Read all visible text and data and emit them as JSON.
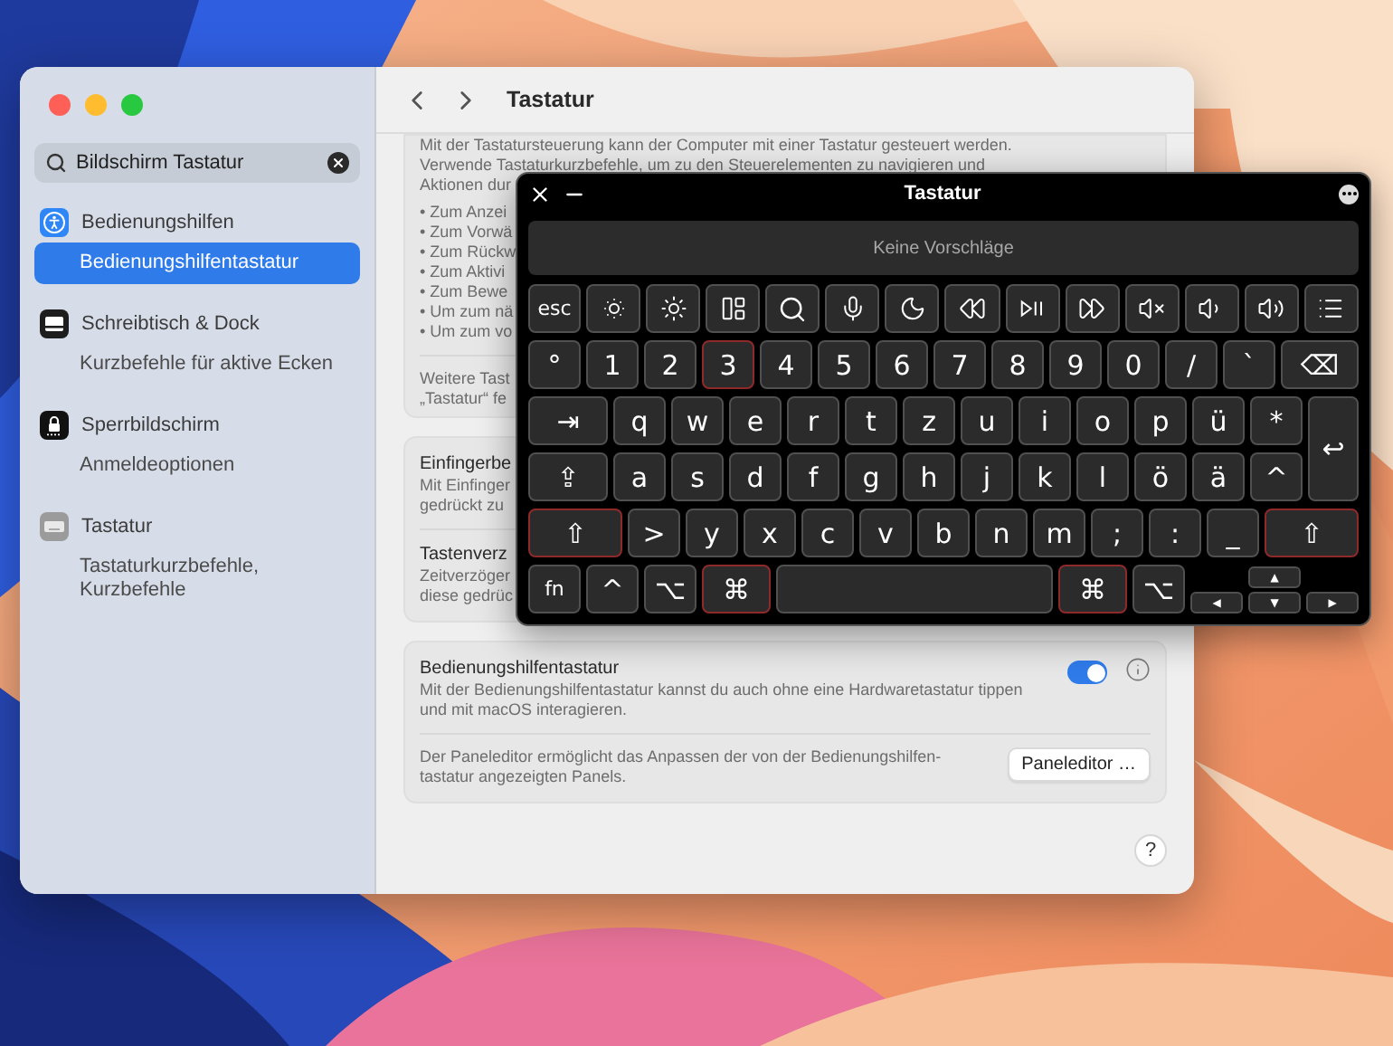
{
  "settings": {
    "search": {
      "value": "Bildschirm Tastatur"
    },
    "sidebar": [
      {
        "title": "Bedienungshilfen",
        "selected": false,
        "items": [
          {
            "label": "Bedienungshilfentastatur",
            "selected": true
          }
        ]
      },
      {
        "title": "Schreibtisch & Dock",
        "selected": false,
        "items": [
          {
            "label": "Kurzbefehle für aktive Ecken",
            "selected": false
          }
        ]
      },
      {
        "title": "Sperrbildschirm",
        "selected": false,
        "items": [
          {
            "label": "Anmeldeoptionen",
            "selected": false
          }
        ]
      },
      {
        "title": "Tastatur",
        "selected": false,
        "items": [
          {
            "label": "Tastaturkurzbefehle, Kurzbefehle",
            "selected": false
          }
        ]
      }
    ],
    "header": {
      "title": "Tastatur"
    },
    "keyboard_control": {
      "lines": [
        "Mit der Tastatursteuerung kann der Computer mit einer Tastatur gesteuert werden.",
        "Verwende Tastaturkurzbefehle, um zu den Steuerelementen zu navigieren und",
        "Aktionen dur"
      ],
      "bullets": [
        "• Zum Anzei",
        "• Zum Vorwä",
        "• Zum Rückw",
        "• Zum Aktivi",
        "• Zum Bewe",
        "• Um zum nä",
        "• Um zum vo"
      ],
      "more_lines": [
        "Weitere Tast",
        "„Tastatur“ fe"
      ]
    },
    "sections": [
      {
        "title": "Einfingerbe",
        "lines": [
          "Mit Einfinger",
          "gedrückt zu"
        ]
      },
      {
        "title": "Tastenverz",
        "lines": [
          "Zeitverzöger",
          "diese gedrüc"
        ]
      }
    ],
    "accessibility_keyboard": {
      "title": "Bedienungshilfentastatur",
      "description": "Mit der Bedienungshilfentastatur kannst du auch ohne eine Hardwaretastatur tippen und mit macOS interagieren.",
      "enabled": true,
      "panel_text": "Der Paneleditor ermöglicht das Anpassen der von der Bedienungshilfen-tastatur angezeigten Panels.",
      "panel_button": "Paneleditor …"
    },
    "help": "?"
  },
  "keyboard": {
    "title": "Tastatur",
    "suggestions": "Keine Vorschläge",
    "key_rows": [
      {
        "keys": [
          {
            "kind": "key",
            "label": "esc",
            "highlighted": false
          },
          {
            "kind": "icon",
            "highlighted": false
          },
          {
            "kind": "icon",
            "highlighted": false
          },
          {
            "kind": "icon",
            "highlighted": false
          },
          {
            "kind": "icon",
            "highlighted": false
          },
          {
            "kind": "icon",
            "highlighted": false
          },
          {
            "kind": "icon",
            "highlighted": false
          },
          {
            "kind": "icon",
            "highlighted": false
          },
          {
            "kind": "icon",
            "highlighted": false
          },
          {
            "kind": "icon",
            "highlighted": false
          },
          {
            "kind": "icon",
            "highlighted": false
          },
          {
            "kind": "icon",
            "highlighted": false
          },
          {
            "kind": "icon",
            "highlighted": false
          },
          {
            "kind": "icon",
            "highlighted": false
          }
        ]
      },
      {
        "keys": [
          {
            "kind": "key",
            "label": "°",
            "highlighted": false
          },
          {
            "kind": "key",
            "label": "1",
            "highlighted": false
          },
          {
            "kind": "key",
            "label": "2",
            "highlighted": false
          },
          {
            "kind": "key",
            "label": "3",
            "highlighted": true
          },
          {
            "kind": "key",
            "label": "4",
            "highlighted": false
          },
          {
            "kind": "key",
            "label": "5",
            "highlighted": false
          },
          {
            "kind": "key",
            "label": "6",
            "highlighted": false
          },
          {
            "kind": "key",
            "label": "7",
            "highlighted": false
          },
          {
            "kind": "key",
            "label": "8",
            "highlighted": false
          },
          {
            "kind": "key",
            "label": "9",
            "highlighted": false
          },
          {
            "kind": "key",
            "label": "0",
            "highlighted": false
          },
          {
            "kind": "key",
            "label": "/",
            "highlighted": false
          },
          {
            "kind": "key",
            "label": "`",
            "highlighted": false
          },
          {
            "kind": "wide",
            "label": "⌫",
            "highlighted": false
          }
        ]
      },
      {
        "keys": [
          {
            "kind": "wide",
            "label": "⇥",
            "highlighted": false
          },
          {
            "kind": "key",
            "label": "q",
            "highlighted": false
          },
          {
            "kind": "key",
            "label": "w",
            "highlighted": false
          },
          {
            "kind": "key",
            "label": "e",
            "highlighted": false
          },
          {
            "kind": "key",
            "label": "r",
            "highlighted": false
          },
          {
            "kind": "key",
            "label": "t",
            "highlighted": false
          },
          {
            "kind": "key",
            "label": "z",
            "highlighted": false
          },
          {
            "kind": "key",
            "label": "u",
            "highlighted": false
          },
          {
            "kind": "key",
            "label": "i",
            "highlighted": false
          },
          {
            "kind": "key",
            "label": "o",
            "highlighted": false
          },
          {
            "kind": "key",
            "label": "p",
            "highlighted": false
          },
          {
            "kind": "key",
            "label": "ü",
            "highlighted": false
          },
          {
            "kind": "key",
            "label": "*",
            "highlighted": false
          }
        ]
      },
      {
        "keys": [
          {
            "kind": "wide",
            "label": "⇪",
            "highlighted": false
          },
          {
            "kind": "key",
            "label": "a",
            "highlighted": false
          },
          {
            "kind": "key",
            "label": "s",
            "highlighted": false
          },
          {
            "kind": "key",
            "label": "d",
            "highlighted": false
          },
          {
            "kind": "key",
            "label": "f",
            "highlighted": false
          },
          {
            "kind": "key",
            "label": "g",
            "highlighted": false
          },
          {
            "kind": "key",
            "label": "h",
            "highlighted": false
          },
          {
            "kind": "key",
            "label": "j",
            "highlighted": false
          },
          {
            "kind": "key",
            "label": "k",
            "highlighted": false
          },
          {
            "kind": "key",
            "label": "l",
            "highlighted": false
          },
          {
            "kind": "key",
            "label": "ö",
            "highlighted": false
          },
          {
            "kind": "key",
            "label": "ä",
            "highlighted": false
          },
          {
            "kind": "key",
            "label": "^",
            "highlighted": false
          }
        ]
      },
      {
        "keys": [
          {
            "kind": "wide",
            "label": "⇧",
            "highlighted": true
          },
          {
            "kind": "key",
            "label": ">",
            "highlighted": false
          },
          {
            "kind": "key",
            "label": "y",
            "highlighted": false
          },
          {
            "kind": "key",
            "label": "x",
            "highlighted": false
          },
          {
            "kind": "key",
            "label": "c",
            "highlighted": false
          },
          {
            "kind": "key",
            "label": "v",
            "highlighted": false
          },
          {
            "kind": "key",
            "label": "b",
            "highlighted": false
          },
          {
            "kind": "key",
            "label": "n",
            "highlighted": false
          },
          {
            "kind": "key",
            "label": "m",
            "highlighted": false
          },
          {
            "kind": "key",
            "label": ";",
            "highlighted": false
          },
          {
            "kind": "key",
            "label": ":",
            "highlighted": false
          },
          {
            "kind": "key",
            "label": "_",
            "highlighted": false
          },
          {
            "kind": "wide",
            "label": "⇧",
            "highlighted": true
          }
        ]
      },
      {
        "keys": [
          {
            "kind": "key",
            "label": "fn",
            "highlighted": false
          },
          {
            "kind": "key",
            "label": "^",
            "highlighted": false
          },
          {
            "kind": "key",
            "label": "⌥",
            "highlighted": false
          },
          {
            "kind": "mod",
            "label": "⌘",
            "highlighted": true
          },
          {
            "kind": "space",
            "highlighted": false
          },
          {
            "kind": "mod",
            "label": "⌘",
            "highlighted": true
          },
          {
            "kind": "key",
            "label": "⌥",
            "highlighted": false
          }
        ]
      }
    ],
    "return_key": {
      "label": "↩",
      "highlighted": false
    },
    "arrow_keys": [
      {
        "label": "▲",
        "highlighted": false
      },
      {
        "label": "◀",
        "highlighted": false
      },
      {
        "label": "▼",
        "highlighted": false
      },
      {
        "label": "▶",
        "highlighted": false
      }
    ]
  }
}
